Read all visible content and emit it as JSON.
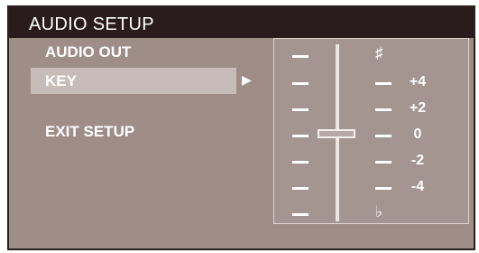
{
  "title": "AUDIO SETUP",
  "menu": {
    "audio_out": "AUDIO OUT",
    "key": "KEY",
    "key_arrow": "▶",
    "exit_setup": "EXIT  SETUP"
  },
  "key_panel": {
    "sharp_symbol": "♯",
    "flat_symbol": "♭",
    "values": [
      "+4",
      "+2",
      "0",
      "-2",
      "-4"
    ],
    "selected_value": "0"
  },
  "colors": {
    "background": "#9e8e87",
    "titlebar": "#2a1c1c",
    "highlight": "#c7bcb8",
    "text": "#ffffff"
  }
}
